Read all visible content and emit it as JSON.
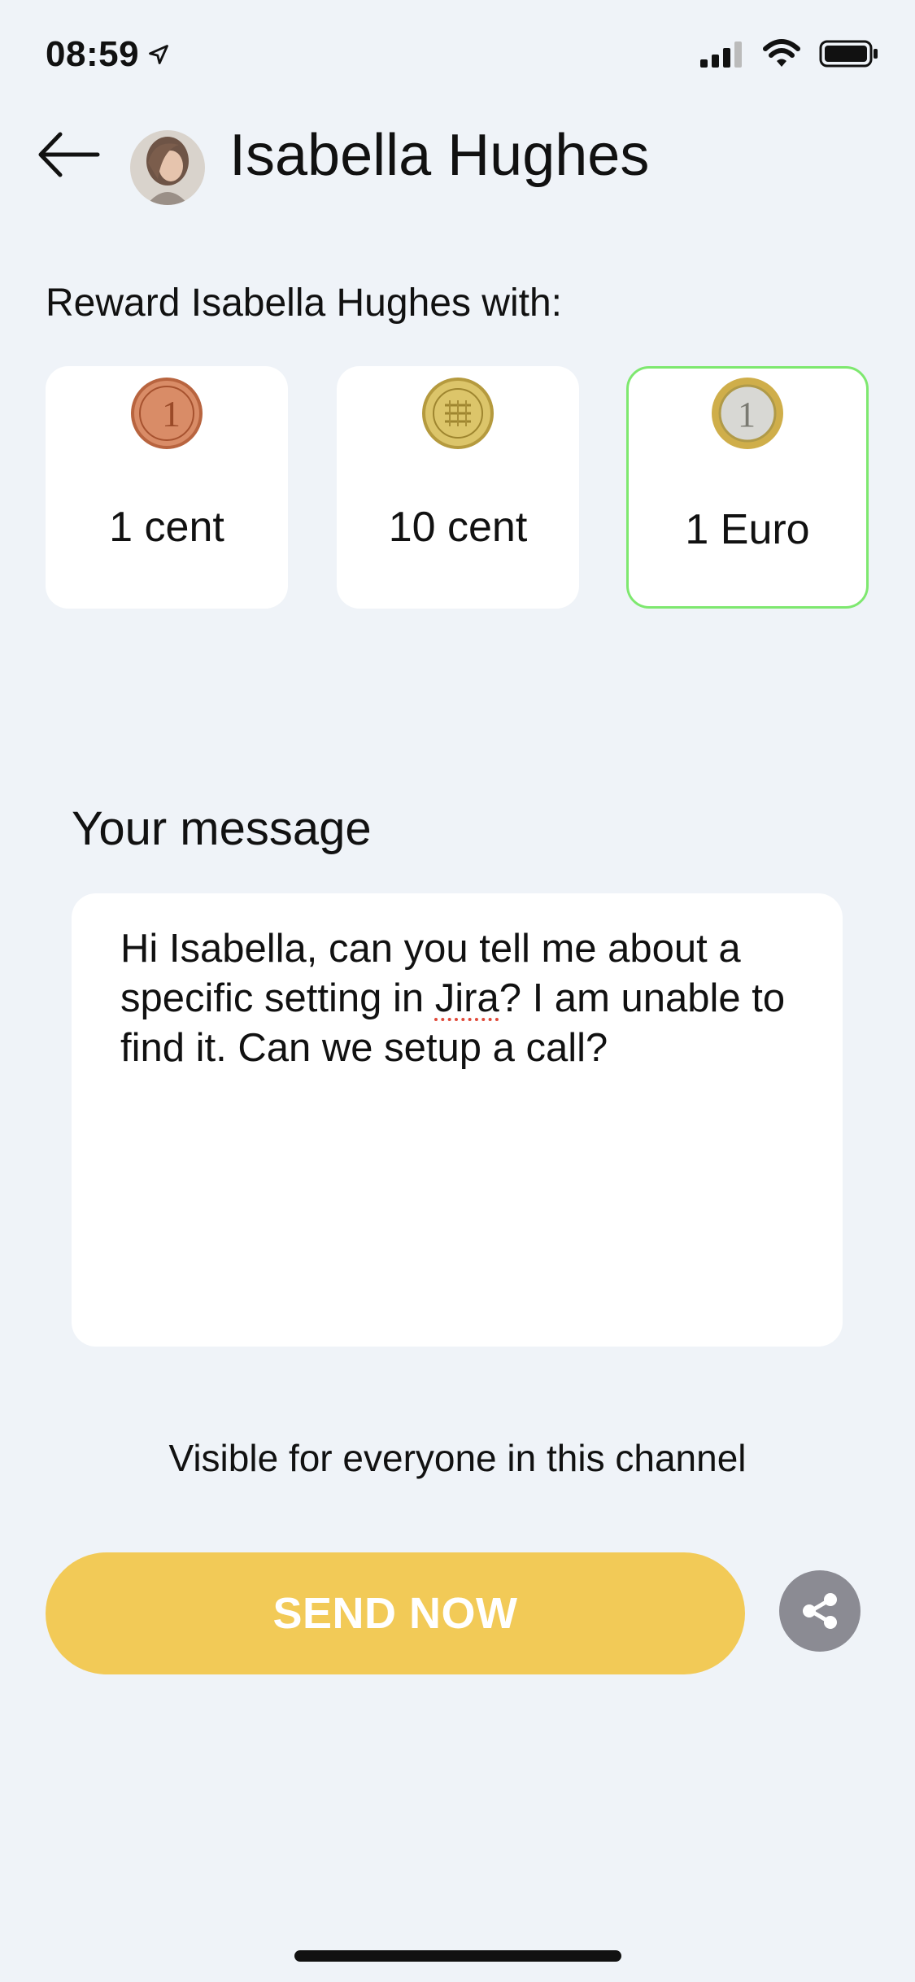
{
  "status_bar": {
    "time": "08:59",
    "icons": [
      "location-arrow-icon",
      "signal-icon",
      "wifi-icon",
      "battery-icon"
    ]
  },
  "header": {
    "title": "Isabella Hughes",
    "back_icon": "arrow-left-icon"
  },
  "reward": {
    "label": "Reward Isabella Hughes with:",
    "options": [
      {
        "label": "1 cent",
        "icon": "copper-coin-icon",
        "selected": false
      },
      {
        "label": "10 cent",
        "icon": "gold-coin-icon",
        "selected": false
      },
      {
        "label": "1 Euro",
        "icon": "euro-coin-icon",
        "selected": true
      }
    ]
  },
  "message": {
    "heading": "Your message",
    "text_before": "Hi Isabella, can you tell me about a specific setting in ",
    "text_flagged": "Jira",
    "text_after": "? I am unable to find it. Can we setup a call?"
  },
  "visibility_note": "Visible for everyone in this channel",
  "actions": {
    "send_label": "SEND NOW",
    "share_icon": "share-icon"
  },
  "colors": {
    "background": "#eff3f8",
    "send_button": "#f2ca57",
    "selected_border": "#7ee86f",
    "share_button": "#8b8b93"
  }
}
